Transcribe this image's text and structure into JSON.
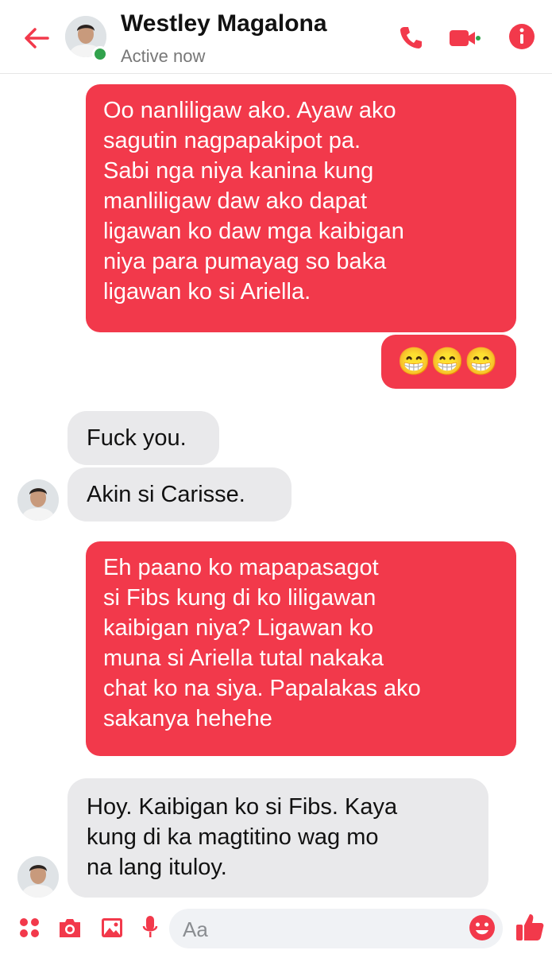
{
  "header": {
    "contact_name": "Westley Magalona",
    "status": "Active now",
    "icons": [
      "back-arrow-icon",
      "phone-icon",
      "video-camera-icon",
      "info-icon"
    ],
    "accent_color": "#f2394b"
  },
  "messages": [
    {
      "from": "me",
      "text": "Oo nanliligaw ako. Ayaw ako\nsagutin nagpapakipot pa.\nSabi nga niya kanina kung\nmanliligaw daw ako dapat\nligawan ko daw mga kaibigan\nniya para pumayag so baka\nligawan ko si Ariella."
    },
    {
      "from": "me",
      "text": "😁😁😁"
    },
    {
      "from": "them",
      "text": "Fuck you."
    },
    {
      "from": "them",
      "text": "Akin si Carisse."
    },
    {
      "from": "me",
      "text": "Eh paano ko mapapasagot\nsi Fibs kung di ko liligawan\nkaibigan niya? Ligawan ko\nmuna si Ariella tutal nakaka\nchat ko na siya. Papalakas ako\nsakanya hehehe"
    },
    {
      "from": "them",
      "text": "Hoy. Kaibigan ko si Fibs. Kaya\nkung di ka magtitino wag mo\nna lang ituloy."
    }
  ],
  "composer": {
    "placeholder": "Aa",
    "icons": [
      "menu-dots-icon",
      "camera-icon",
      "image-icon",
      "microphone-icon",
      "emoji-icon",
      "like-icon"
    ]
  },
  "colors": {
    "my_bubble": "#f2394b",
    "their_bubble": "#e9e9eb"
  }
}
